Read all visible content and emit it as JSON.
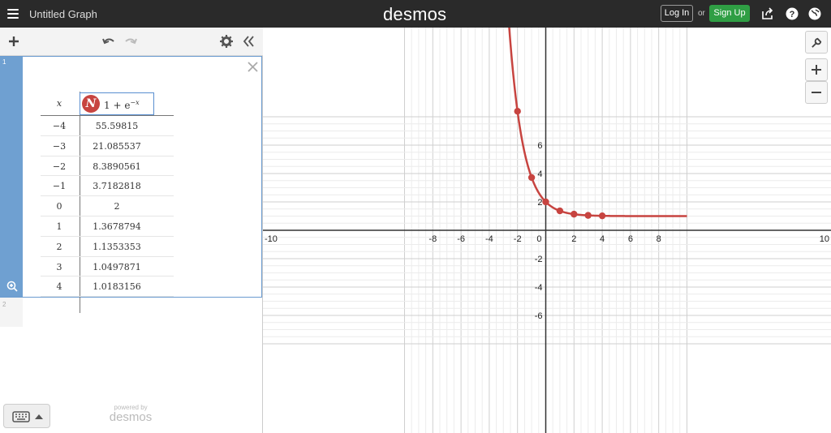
{
  "header": {
    "title": "Untitled Graph",
    "brand": "desmos",
    "login_label": "Log In",
    "or_label": "or",
    "signup_label": "Sign Up"
  },
  "expression_list": {
    "items": [
      {
        "index": "1",
        "type": "table",
        "x_header": "x",
        "y_header_base": "1 + e",
        "y_header_exp": "−x",
        "icon_letter": "N",
        "rows": [
          {
            "x": "−4",
            "y": "55.59815"
          },
          {
            "x": "−3",
            "y": "21.085537"
          },
          {
            "x": "−2",
            "y": "8.3890561"
          },
          {
            "x": "−1",
            "y": "3.7182818"
          },
          {
            "x": "0",
            "y": "2"
          },
          {
            "x": "1",
            "y": "1.3678794"
          },
          {
            "x": "2",
            "y": "1.1353353"
          },
          {
            "x": "3",
            "y": "1.0497871"
          },
          {
            "x": "4",
            "y": "1.0183156"
          }
        ]
      },
      {
        "index": "2",
        "type": "empty"
      }
    ]
  },
  "footer": {
    "powered_by": "powered by",
    "powered_brand": "desmos"
  },
  "graph": {
    "x_ticks": [
      "-10",
      "-8",
      "-6",
      "-4",
      "-2",
      "0",
      "2",
      "4",
      "6",
      "8",
      "10"
    ],
    "y_ticks": [
      "6",
      "4",
      "2",
      "-2",
      "-4",
      "-6"
    ],
    "curve_color": "#c74440",
    "function": "1 + e^(-x)"
  },
  "chart_data": {
    "type": "line",
    "title": "",
    "xlabel": "",
    "ylabel": "",
    "xlim": [
      -10,
      10
    ],
    "ylim": [
      -7,
      7
    ],
    "series": [
      {
        "name": "",
        "x": [
          -4,
          -3,
          -2,
          -1,
          0,
          1,
          2,
          3,
          4
        ],
        "y": [
          55.59815,
          21.085537,
          8.3890561,
          3.7182818,
          2,
          1.3678794,
          1.1353353,
          1.0497871,
          1.0183156
        ]
      }
    ],
    "grid": true
  }
}
